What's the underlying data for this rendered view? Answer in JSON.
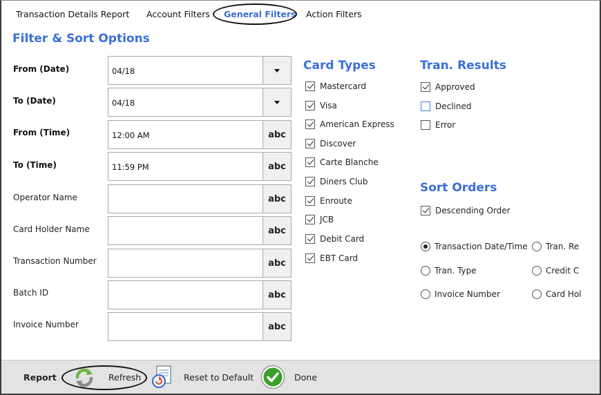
{
  "tabs": [
    {
      "label": "Transaction Details Report"
    },
    {
      "label": "Account Filters"
    },
    {
      "label": "General Filters",
      "active": true
    },
    {
      "label": "Action Filters"
    }
  ],
  "filter_sort": {
    "title": "Filter & Sort Options",
    "fields": [
      {
        "label": "From (Date)",
        "value": "04/18",
        "control": "dropdown"
      },
      {
        "label": "To (Date)",
        "value": "04/18",
        "control": "dropdown"
      },
      {
        "label": "From (Time)",
        "value": "12:00 AM",
        "control": "abc"
      },
      {
        "label": "To (Time)",
        "value": "11:59 PM",
        "control": "abc"
      },
      {
        "label": "Operator Name",
        "value": "",
        "control": "abc"
      },
      {
        "label": "Card Holder Name",
        "value": "",
        "control": "abc"
      },
      {
        "label": "Transaction Number",
        "value": "",
        "control": "abc"
      },
      {
        "label": "Batch ID",
        "value": "",
        "control": "abc"
      },
      {
        "label": "Invoice Number",
        "value": "",
        "control": "abc"
      }
    ],
    "abc_label": "abc"
  },
  "card_types": {
    "title": "Card Types",
    "items": [
      {
        "label": "Mastercard",
        "checked": true
      },
      {
        "label": "Visa",
        "checked": true
      },
      {
        "label": "American Express",
        "checked": true
      },
      {
        "label": "Discover",
        "checked": true
      },
      {
        "label": "Carte Blanche",
        "checked": true
      },
      {
        "label": "Diners Club",
        "checked": true
      },
      {
        "label": "Enroute",
        "checked": true
      },
      {
        "label": "JCB",
        "checked": true
      },
      {
        "label": "Debit Card",
        "checked": true
      },
      {
        "label": "EBT Card",
        "checked": true
      }
    ]
  },
  "tran_results": {
    "title": "Tran. Results",
    "items": [
      {
        "label": "Approved",
        "checked": true
      },
      {
        "label": "Declined",
        "checked": false
      },
      {
        "label": "Error",
        "checked": false
      }
    ]
  },
  "sort_orders": {
    "title": "Sort Orders",
    "descending": {
      "label": "Descending Order",
      "checked": true
    },
    "options": [
      {
        "label": "Transaction Date/Time",
        "selected": true
      },
      {
        "label": "Tran. Re",
        "selected": false
      },
      {
        "label": "Tran. Type",
        "selected": false
      },
      {
        "label": "Credit C",
        "selected": false
      },
      {
        "label": "Invoice Number",
        "selected": false
      },
      {
        "label": "Card Hol",
        "selected": false
      }
    ]
  },
  "footer": {
    "report_label": "Report",
    "refresh_label": "Refresh",
    "reset_label": "Reset to Default",
    "done_label": "Done"
  },
  "colors": {
    "accent": "#3a6fd8",
    "footer_bg": "#e3e3e3",
    "done_green": "#3aa02a"
  },
  "icons": [
    "chevron-down-icon",
    "refresh-icon",
    "reset-icon",
    "done-check-icon"
  ]
}
